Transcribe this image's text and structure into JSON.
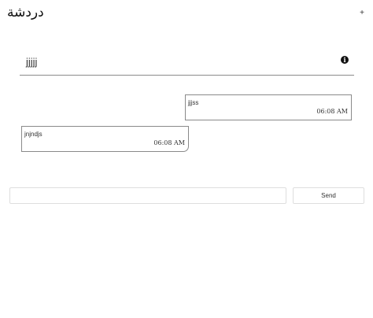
{
  "header": {
    "title": "دردشة",
    "add_icon_glyph": "+"
  },
  "chat": {
    "contact_name": "jjjjj",
    "info_icon": "info-icon",
    "info_glyph": "i"
  },
  "messages": [
    {
      "direction": "outgoing",
      "text": "jjjss",
      "time": "06:08 AM"
    },
    {
      "direction": "incoming",
      "text": "jnjndjs",
      "time": "06:08 AM"
    }
  ],
  "composer": {
    "value": "",
    "placeholder": "",
    "send_label": "Send"
  }
}
